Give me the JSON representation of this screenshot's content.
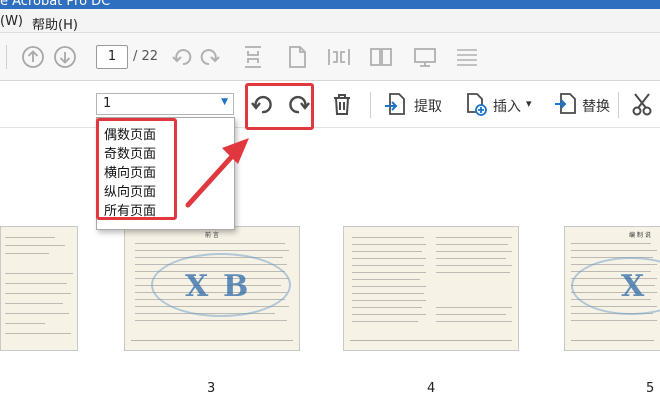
{
  "window": {
    "title": "e Acrobat Pro DC"
  },
  "menubar": {
    "items": [
      "(W)",
      "帮助(H)"
    ]
  },
  "toolbar": {
    "current_page": "1",
    "page_total": "/ 22",
    "icons": [
      "up-arrow-icon",
      "down-arrow-icon",
      "rotate-left-icon",
      "rotate-right-icon",
      "fit-height-icon",
      "page-icon",
      "fit-width-icon",
      "two-page-icon",
      "monitor-icon",
      "menu-icon"
    ]
  },
  "organize": {
    "page_range_value": "1",
    "extract_label": "提取",
    "insert_label": "插入",
    "replace_label": "替换",
    "insert_caret": "▾"
  },
  "dropdown": {
    "options": [
      "偶数页面",
      "奇数页面",
      "横向页面",
      "纵向页面",
      "所有页面"
    ]
  },
  "thumbnails": {
    "page_numbers": [
      "3",
      "4",
      "5"
    ],
    "page_titles": [
      "前  言",
      "编  制  说"
    ]
  },
  "colors": {
    "annotation_red": "#e0383e",
    "accent_blue": "#1a73c8",
    "titlebar_blue": "#2f6fbf"
  }
}
